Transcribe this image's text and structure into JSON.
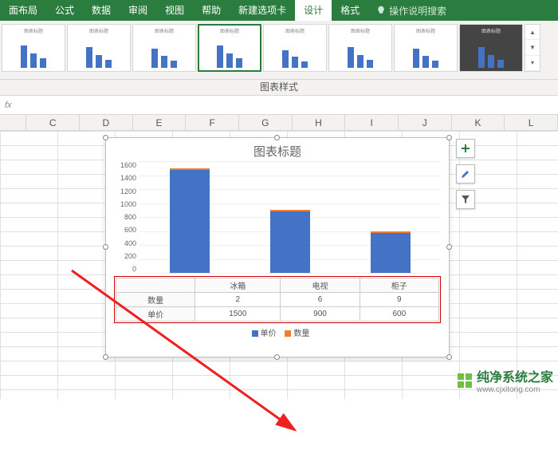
{
  "ribbon": {
    "tabs": [
      "面布局",
      "公式",
      "数据",
      "审阅",
      "视图",
      "帮助",
      "新建选项卡",
      "设计",
      "格式"
    ],
    "tell_me": "操作说明搜索",
    "styles_label": "图表样式"
  },
  "formula_bar": {
    "fx": "fx"
  },
  "columns": [
    "C",
    "D",
    "E",
    "F",
    "G",
    "H",
    "I",
    "J",
    "K",
    "L"
  ],
  "chart_data": {
    "type": "bar",
    "title": "图表标题",
    "categories": [
      "冰箱",
      "电视",
      "柜子"
    ],
    "series": [
      {
        "name": "单价",
        "values": [
          1500,
          900,
          600
        ]
      },
      {
        "name": "数量",
        "values": [
          2,
          6,
          9
        ]
      }
    ],
    "ylim": [
      0,
      1600
    ],
    "yticks": [
      0,
      200,
      400,
      600,
      800,
      1000,
      1200,
      1400,
      1600
    ],
    "data_table": {
      "row_headers": [
        "数量",
        "单价"
      ],
      "rows": [
        [
          2,
          6,
          9
        ],
        [
          1500,
          900,
          600
        ]
      ]
    },
    "legend": [
      "单价",
      "数量"
    ]
  },
  "side_buttons": [
    "add",
    "brush",
    "filter"
  ],
  "watermark": {
    "brand": "纯净系统之家",
    "url": "www.cjxitong.com"
  }
}
